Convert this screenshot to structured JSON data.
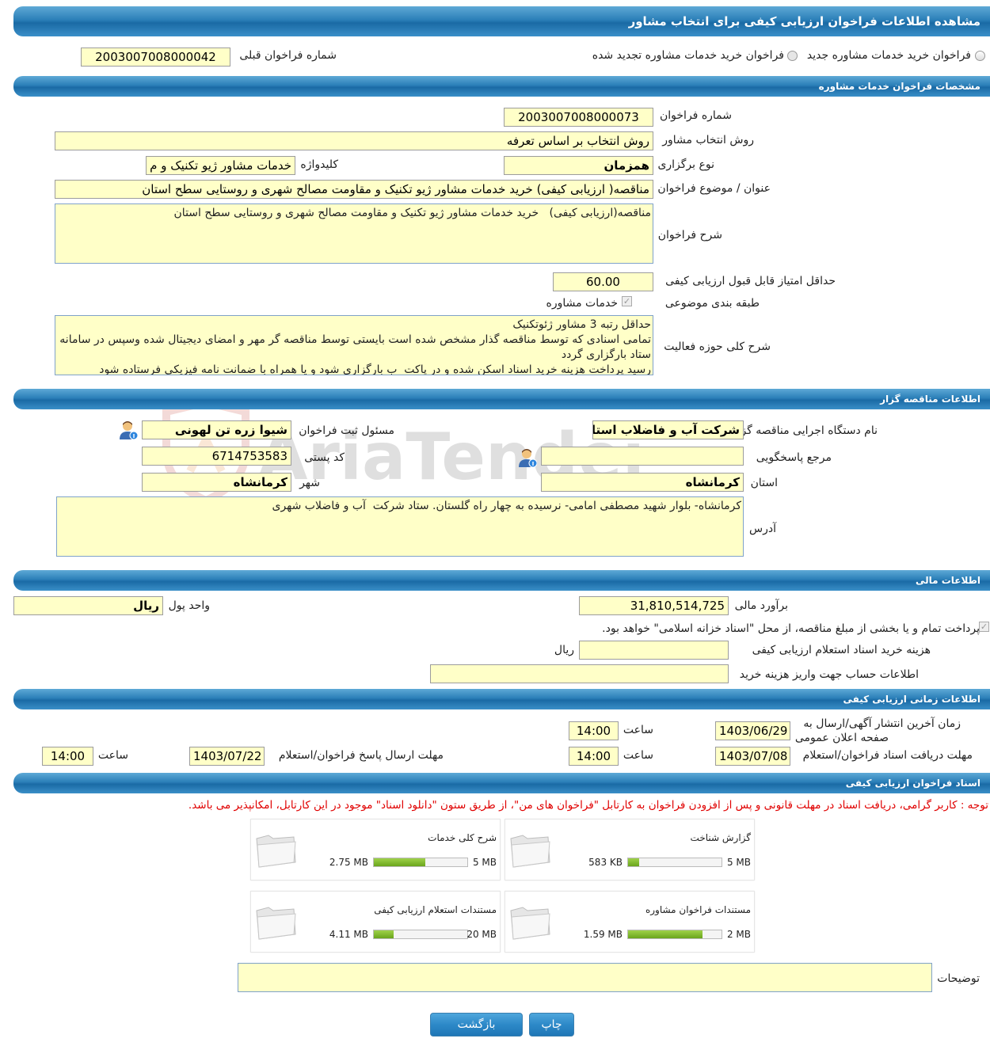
{
  "page_title": "مشاهده اطلاعات فراخوان ارزیابی کیفی برای انتخاب مشاور",
  "radios": {
    "new_label": "فراخوان خرید خدمات مشاوره جدید",
    "renewed_label": "فراخوان خرید خدمات مشاوره تجدید شده"
  },
  "previous_tender": {
    "label": "شماره فراخوان قبلی",
    "value": "2003007008000042"
  },
  "sections": {
    "consulting": "مشخصات فراخوان خدمات مشاوره",
    "tenderer": "اطلاعات مناقصه گزار",
    "financial": "اطلاعات مالی",
    "timing": "اطلاعات زمانی ارزیابی کیفی",
    "documents": "اسناد فراخوان ارزیابی کیفی"
  },
  "consulting": {
    "tender_number_label": "شماره فراخوان",
    "tender_number": "2003007008000073",
    "method_label": "روش انتخاب مشاور",
    "method": "روش انتخاب بر اساس تعرفه",
    "holding_type_label": "نوع برگزاری",
    "holding_type": "همزمان",
    "keyword_label": "کلیدواژه",
    "keyword": "خدمات مشاور ژیو تکنیک و م",
    "subject_label": "عنوان / موضوع فراخوان",
    "subject": "مناقصه( ارزیابی کیفی) خرید خدمات مشاور ژیو تکنیک و مقاومت مصالح شهری و روستایی سطح استان",
    "description_label": "شرح فراخوان",
    "description": "مناقصه(ارزیابی کیفی)   خرید خدمات مشاور ژیو تکنیک و مقاومت مصالح شهری و روستایی سطح استان",
    "min_score_label": "حداقل امتیاز قابل قبول ارزیابی کیفی",
    "min_score": "60.00",
    "category_label": "طبقه بندی موضوعی",
    "category_value": "خدمات مشاوره",
    "scope_label": "شرح کلی حوزه فعالیت",
    "scope": "حداقل رتبه 3 مشاور ژئوتکنیک\nتمامی اسنادی که توسط مناقصه گذار مشخص شده است بایستی توسط مناقصه گر مهر و امضای دیجیتال شده وسپس در سامانه ستاد بارگزاری گردد\nرسید پرداخت هزینه خرید اسناد اسکن شده و در پاکت  ب بارگزاری شود و یا همراه با ضمانت نامه فیزیکی فرستاده شود"
  },
  "tenderer": {
    "org_label": "نام دستگاه اجرایی مناقصه گزار",
    "org": "شرکت آب و فاضلاب استان",
    "registrar_label": "مسئول ثبت فراخوان",
    "registrar": "شیوا زره تن لهونی",
    "reference_label": "مرجع پاسخگویی",
    "reference": "",
    "postal_label": "کد پستی",
    "postal": "6714753583",
    "province_label": "استان",
    "province": "کرمانشاه",
    "city_label": "شهر",
    "city": "کرمانشاه",
    "address_label": "آدرس",
    "address": "کرمانشاه- بلوار شهید مصطفی امامی- نرسیده به چهار راه گلستان. ستاد شرکت  آب و فاضلاب شهری"
  },
  "financial": {
    "estimate_label": "برآورد مالی",
    "estimate": "31,810,514,725",
    "currency_label": "واحد پول",
    "currency": "ریال",
    "treasury_text": "پرداخت تمام و یا بخشی از مبلغ مناقصه، از محل \"اسناد خزانه اسلامی\" خواهد بود.",
    "doc_fee_label": "هزینه خرید اسناد استعلام ارزیابی کیفی",
    "doc_fee": "",
    "doc_fee_unit": "ریال",
    "account_label": "اطلاعات حساب جهت واریز هزینه خرید",
    "account": ""
  },
  "timing": {
    "publish_label_1": "زمان آخرین انتشار آگهی/ارسال به",
    "publish_label_2": "صفحه اعلان عمومی",
    "publish_date": "1403/06/29",
    "publish_time_label": "ساعت",
    "publish_time": "14:00",
    "receive_label": "مهلت دریافت اسناد فراخوان/استعلام",
    "receive_date": "1403/07/08",
    "receive_time_label": "ساعت",
    "receive_time": "14:00",
    "response_label": "مهلت ارسال پاسخ فراخوان/استعلام",
    "response_date": "1403/07/22",
    "response_time_label": "ساعت",
    "response_time": "14:00"
  },
  "documents": {
    "notice": "توجه : کاربر گرامی، دریافت اسناد در مهلت قانونی و پس از افزودن فراخوان به کارتابل \"فراخوان های من\"، از طریق ستون \"دانلود اسناد\" موجود در این کارتابل، امکانپذیر می باشد.",
    "notice_color": "#e00000",
    "files": [
      {
        "title": "گزارش شناخت",
        "size": "583 KB",
        "max": "5 MB",
        "fill": 0.12
      },
      {
        "title": "شرح کلی خدمات",
        "size": "2.75 MB",
        "max": "5 MB",
        "fill": 0.55
      },
      {
        "title": "مستندات فراخوان مشاوره",
        "size": "1.59 MB",
        "max": "2 MB",
        "fill": 0.8
      },
      {
        "title": "مستندات استعلام ارزیابی کیفی",
        "size": "4.11 MB",
        "max": "20 MB",
        "fill": 0.21
      }
    ],
    "notes_label": "توضیحات",
    "notes": ""
  },
  "buttons": {
    "print": "چاپ",
    "back": "بازگشت"
  },
  "watermark": "AriaTender.net",
  "accent_color": "#2b7fb8",
  "field_color": "#ffffc8"
}
